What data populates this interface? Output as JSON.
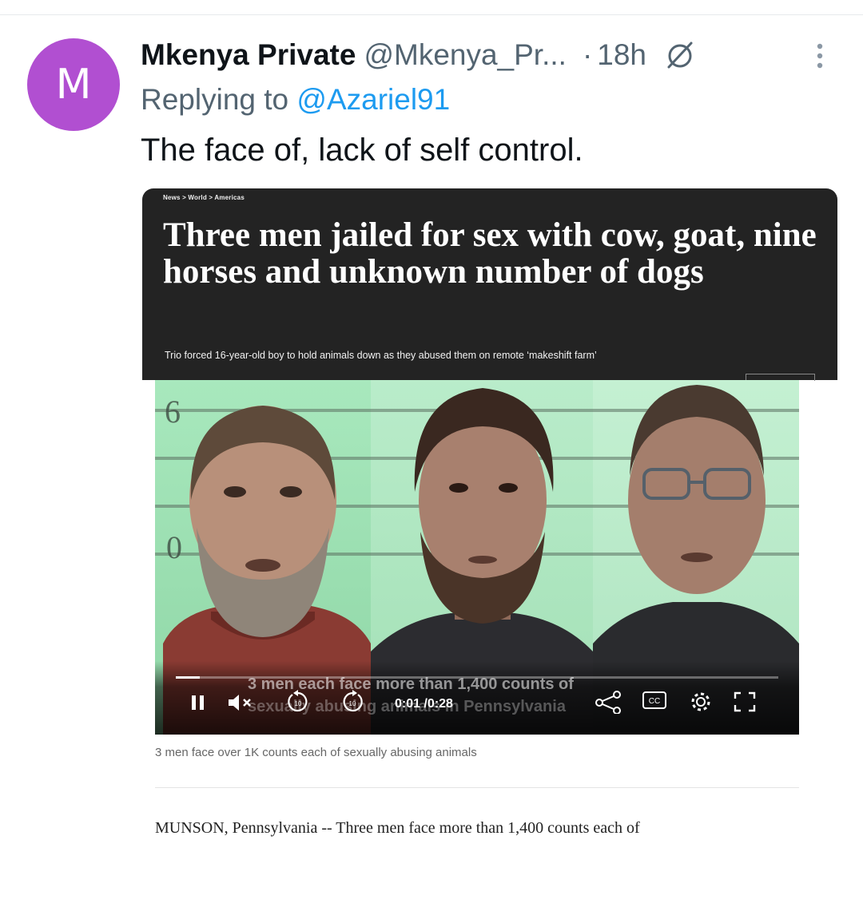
{
  "tweet": {
    "avatar_letter": "M",
    "author_name": "Mkenya Private",
    "author_handle": "@Mkenya_Pr...",
    "separator": "·",
    "time": "18h",
    "replying_prefix": "Replying to ",
    "replying_handle": "@Azariel91",
    "text": "The face of, lack of self control.",
    "colors": {
      "avatar": "#b14fd1",
      "link": "#1d9bf0",
      "muted": "#536471"
    }
  },
  "article": {
    "breadcrumb": "News > World > Americas",
    "headline": "Three men jailed for sex with cow, goat, nine horses and unknown number of dogs",
    "subheadline": "Trio forced 16-year-old boy to hold animals down as they abused them on remote ‘makeshift farm’",
    "video": {
      "caption_line1": "3 men each face more than 1,400 counts of",
      "caption_line2": "sexually abusing animals in Pennsylvania",
      "current_time": "0:01",
      "duration": "/0:28",
      "progress_fraction": 0.04,
      "scale_labels": [
        "6",
        "0"
      ],
      "icons": [
        "pause-icon",
        "mute-icon",
        "rewind-10-icon",
        "forward-10-icon",
        "share-icon",
        "cc-icon",
        "settings-icon",
        "fullscreen-icon"
      ],
      "cc_label": "CC",
      "rewind_label": "10",
      "forward_label": "10"
    },
    "caption": "3 men face over 1K counts each of sexually abusing animals",
    "body_start": "MUNSON, Pennsylvania -- Three men face more than 1,400 counts each of"
  }
}
